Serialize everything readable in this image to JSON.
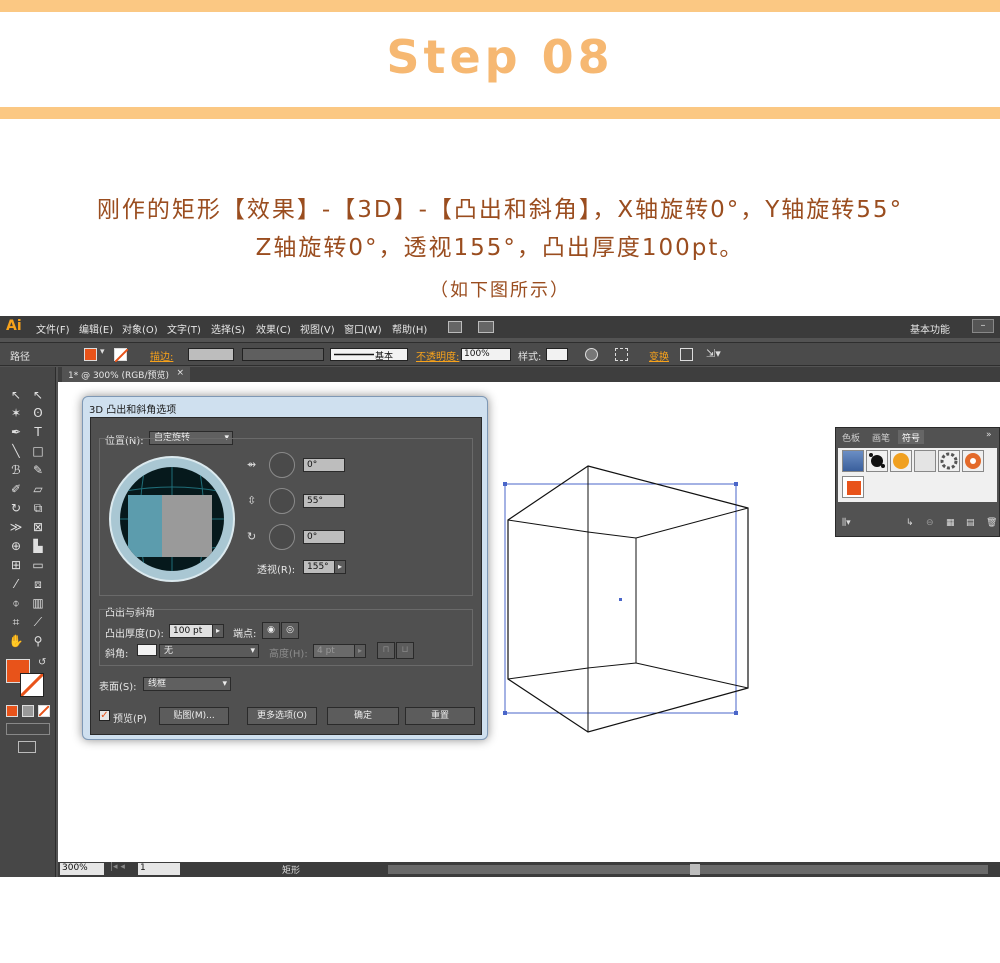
{
  "header": {
    "step_title": "Step 08",
    "desc_line1": "刚作的矩形【效果】-【3D】-【凸出和斜角】，X轴旋转0°，Y轴旋转55°",
    "desc_line2": "Z轴旋转0°，透视155°，凸出厚度100pt。",
    "note": "（如下图所示）"
  },
  "menubar": {
    "logo": "Ai",
    "items": [
      "文件(F)",
      "编辑(E)",
      "对象(O)",
      "文字(T)",
      "选择(S)",
      "效果(C)",
      "视图(V)",
      "窗口(W)",
      "帮助(H)"
    ],
    "workspace": "基本功能"
  },
  "controlbar": {
    "path_label": "路径",
    "stroke_label": "描边:",
    "line_style": "基本",
    "opacity_label": "不透明度:",
    "opacity_value": "100%",
    "style_label": "样式:",
    "transform_label": "变换"
  },
  "document_tab": {
    "label": "1* @ 300% (RGB/预览)",
    "close": "×"
  },
  "dialog": {
    "title": "3D 凸出和斜角选项",
    "position_label": "位置(N):",
    "position_value": "自定旋转",
    "x_rotation": "0°",
    "y_rotation": "55°",
    "z_rotation": "0°",
    "perspective_label": "透视(R):",
    "perspective_value": "155°",
    "extrude_group": "凸出与斜角",
    "extrude_depth_label": "凸出厚度(D):",
    "extrude_depth_value": "100 pt",
    "cap_label": "端点:",
    "bevel_label": "斜角:",
    "bevel_value": "无",
    "height_label": "高度(H):",
    "height_value": "4 pt",
    "surface_label": "表面(S):",
    "surface_value": "线框",
    "preview_label": "预览(P)",
    "preview_checked": true,
    "map_button": "贴图(M)...",
    "more_button": "更多选项(O)",
    "ok_button": "确定",
    "reset_button": "重置"
  },
  "symbols_panel": {
    "tabs": [
      "色板",
      "画笔",
      "符号"
    ],
    "active_tab": "符号"
  },
  "statusbar": {
    "zoom": "300%",
    "page": "1",
    "selection": "矩形"
  },
  "colors": {
    "accent_orange": "#e8531a",
    "header_bar": "#fbc883",
    "desc_text": "#9a4d1f"
  }
}
